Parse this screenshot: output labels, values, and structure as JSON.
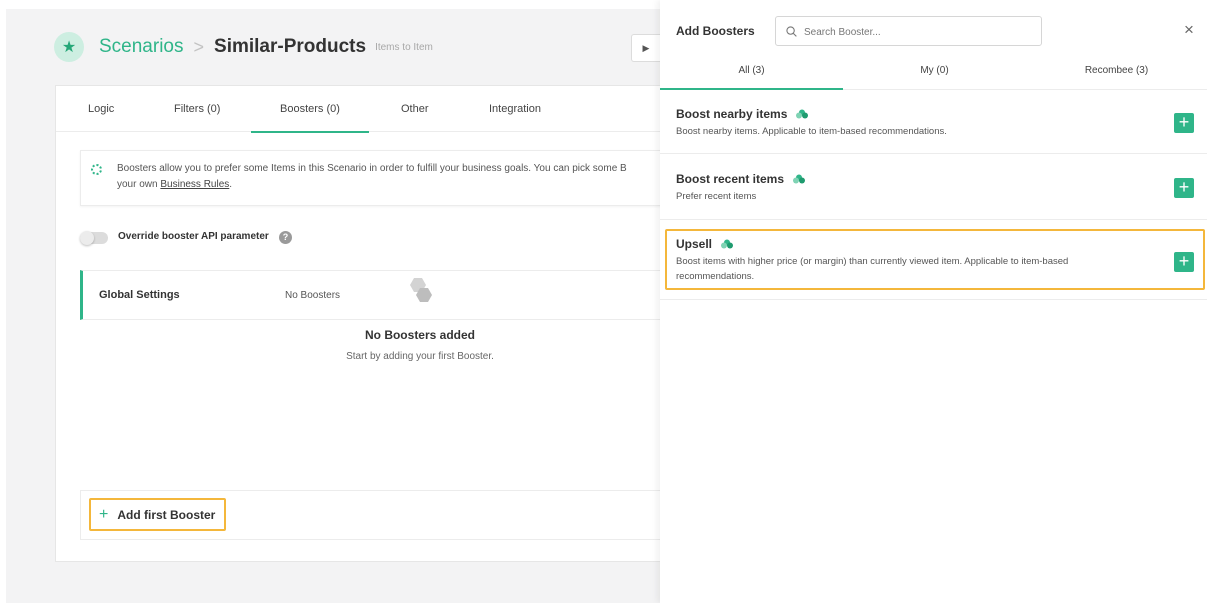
{
  "header": {
    "breadcrumb_root": "Scenarios",
    "breadcrumb_separator": ">",
    "current": "Similar-Products",
    "subtitle": "Items to Item"
  },
  "tabs": [
    "Logic",
    "Filters (0)",
    "Boosters (0)",
    "Other",
    "Integration"
  ],
  "active_tab": "Boosters (0)",
  "info": {
    "text": "Boosters allow you to prefer some Items in this Scenario in order to fulfill your business goals. You can pick some B",
    "text_line2_prefix": "your own",
    "link": "Business Rules",
    "text_line2_suffix": "."
  },
  "override": {
    "label": "Override booster API parameter",
    "enabled": false,
    "help": "?"
  },
  "global_settings": {
    "title": "Global Settings",
    "value": "No Boosters"
  },
  "empty_state": {
    "title": "No Boosters added",
    "subtitle": "Start by adding your first Booster."
  },
  "add_first": {
    "plus": "+",
    "label": "Add first Booster"
  },
  "panel": {
    "title": "Add Boosters",
    "search_placeholder": "Search Booster...",
    "close": "×",
    "tabs": [
      "All (3)",
      "My (0)",
      "Recombee (3)"
    ],
    "active_tab": "All (3)",
    "items": [
      {
        "title": "Boost nearby items",
        "desc_line1": "Boost nearby items. Applicable to item-based recommendations.",
        "desc_line2": "",
        "add": "+"
      },
      {
        "title": "Boost recent items",
        "desc_line1": "Prefer recent items",
        "desc_line2": "",
        "add": "+"
      },
      {
        "title": "Upsell",
        "desc_line1": "Boost items with higher price (or margin) than currently viewed item. Applicable to item-based",
        "desc_line2": "recommendations.",
        "add": "+"
      }
    ]
  },
  "colors": {
    "accent": "#2fb589",
    "highlight": "#f4b73b",
    "background": "#f3f3f4"
  }
}
